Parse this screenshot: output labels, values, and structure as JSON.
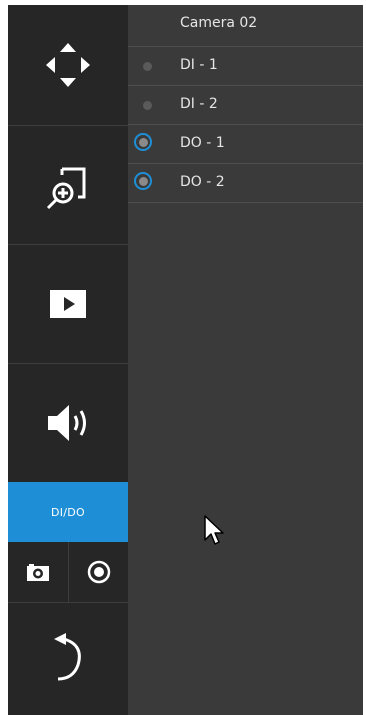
{
  "toolbar": {
    "buttons": [
      {
        "name": "ptz",
        "icon": "arrows-move-icon"
      },
      {
        "name": "zoom",
        "icon": "zoom-in-icon"
      },
      {
        "name": "playback",
        "icon": "play-icon"
      },
      {
        "name": "audio",
        "icon": "speaker-icon"
      },
      {
        "name": "dido",
        "label": "DI/DO",
        "active": true
      },
      {
        "name": "snapshot",
        "icon": "camera-icon"
      },
      {
        "name": "record",
        "icon": "record-icon"
      },
      {
        "name": "back",
        "icon": "undo-arrow-icon"
      }
    ],
    "dido_label": "DI/DO"
  },
  "panel": {
    "title": "Camera 02",
    "rows": [
      {
        "label": "DI - 1",
        "type": "input"
      },
      {
        "label": "DI - 2",
        "type": "input"
      },
      {
        "label": "DO - 1",
        "type": "output"
      },
      {
        "label": "DO - 2",
        "type": "output"
      }
    ]
  },
  "colors": {
    "toolbar_bg": "#262626",
    "panel_bg": "#3a3a3a",
    "accent": "#1e8fd6",
    "text": "#e6e6e6"
  }
}
